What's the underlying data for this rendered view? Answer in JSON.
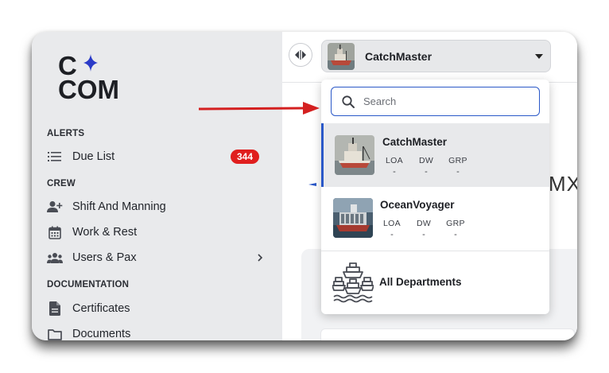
{
  "logo": {
    "line1": "C",
    "line2": "COM",
    "star_color": "#2b3bc8"
  },
  "sidebar": {
    "sections": [
      {
        "title": "ALERTS"
      },
      {
        "title": "CREW"
      },
      {
        "title": "DOCUMENTATION"
      }
    ],
    "items": [
      {
        "label": "Due List",
        "icon": "list-icon",
        "badge": "344"
      },
      {
        "label": "Shift And Manning",
        "icon": "add-user-icon"
      },
      {
        "label": "Work & Rest",
        "icon": "calendar-icon"
      },
      {
        "label": "Users & Pax",
        "icon": "group-icon",
        "has_submenu": true
      },
      {
        "label": "Certificates",
        "icon": "document-icon"
      },
      {
        "label": "Documents",
        "icon": "folder-icon"
      }
    ]
  },
  "header": {
    "selected_vessel": "CatchMaster"
  },
  "main": {
    "partial_text": "MX"
  },
  "dropdown": {
    "search_placeholder": "Search",
    "options": [
      {
        "name": "CatchMaster",
        "stats": [
          {
            "label": "LOA",
            "value": "-"
          },
          {
            "label": "DW",
            "value": "-"
          },
          {
            "label": "GRP",
            "value": "-"
          }
        ],
        "selected": true
      },
      {
        "name": "OceanVoyager",
        "stats": [
          {
            "label": "LOA",
            "value": "-"
          },
          {
            "label": "DW",
            "value": "-"
          },
          {
            "label": "GRP",
            "value": "-"
          }
        ],
        "selected": false
      }
    ],
    "all_departments": "All Departments"
  },
  "colors": {
    "accent": "#2a58c8",
    "badge": "#e01e1e",
    "sidebar_bg": "#e9eaec",
    "arrow": "#d42020"
  }
}
